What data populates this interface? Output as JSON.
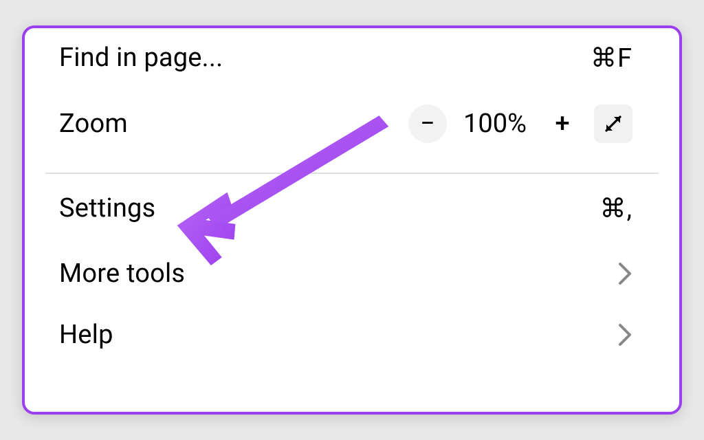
{
  "menu": {
    "find_label": "Find in page...",
    "find_shortcut": "⌘F",
    "zoom_label": "Zoom",
    "zoom_value": "100%",
    "settings_label": "Settings",
    "settings_shortcut": "⌘,",
    "more_tools_label": "More tools",
    "help_label": "Help"
  },
  "glyphs": {
    "minus": "−",
    "plus": "+"
  }
}
